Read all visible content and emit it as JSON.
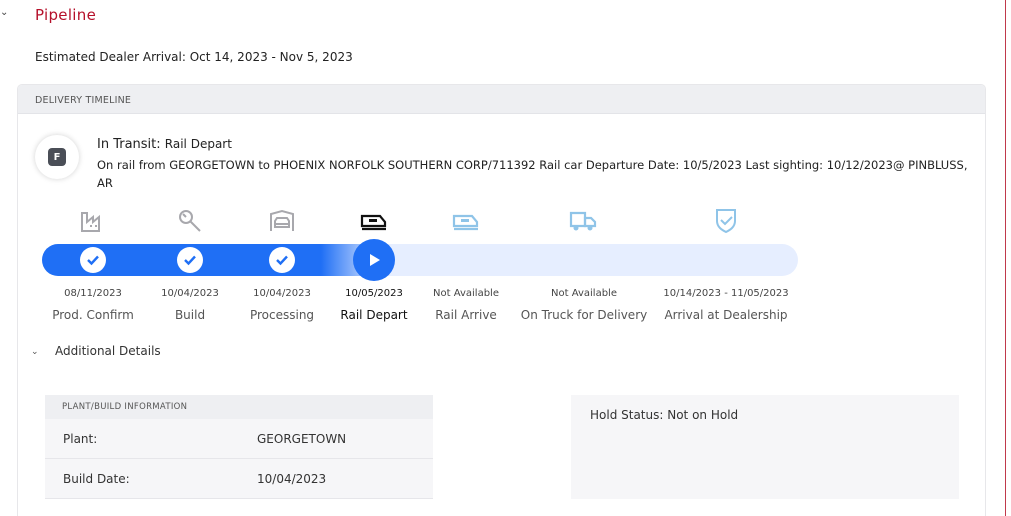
{
  "header": {
    "title": "Pipeline",
    "estimated_arrival": "Estimated Dealer Arrival: Oct 14, 2023 - Nov 5, 2023"
  },
  "timeline": {
    "section_title": "DELIVERY TIMELINE",
    "badge_letter": "F",
    "status_label": "In Transit:",
    "status_sub": "Rail Depart",
    "description": "On rail from GEORGETOWN to PHOENIX NORFOLK SOUTHERN CORP/711392 Rail car Departure Date: 10/5/2023 Last sighting: 10/12/2023@ PINBLUSS, AR",
    "stages": [
      {
        "label": "Prod. Confirm",
        "date": "08/11/2023",
        "state": "complete",
        "icon": "factory-icon"
      },
      {
        "label": "Build",
        "date": "10/04/2023",
        "state": "complete",
        "icon": "wrench-icon"
      },
      {
        "label": "Processing",
        "date": "10/04/2023",
        "state": "complete",
        "icon": "car-processing-icon"
      },
      {
        "label": "Rail Depart",
        "date": "10/05/2023",
        "state": "current",
        "icon": "train-icon"
      },
      {
        "label": "Rail Arrive",
        "date": "Not Available",
        "state": "upcoming",
        "icon": "train-icon"
      },
      {
        "label": "On Truck for Delivery",
        "date": "Not Available",
        "state": "upcoming",
        "icon": "truck-icon"
      },
      {
        "label": "Arrival at Dealership",
        "date": "10/14/2023 - 11/05/2023",
        "state": "upcoming",
        "icon": "shield-check-icon"
      }
    ],
    "colors": {
      "accent": "#1f6ff5",
      "track": "#e6eeff",
      "pending_icon": "#8fc4e8",
      "done_icon": "#a8a8ad",
      "brand": "#b5102a"
    }
  },
  "details": {
    "toggle_label": "Additional Details",
    "plant_section_title": "PLANT/BUILD INFORMATION",
    "rows": [
      {
        "key": "Plant:",
        "value": "GEORGETOWN"
      },
      {
        "key": "Build Date:",
        "value": "10/04/2023"
      }
    ],
    "hold_status": "Hold Status: Not on Hold"
  }
}
